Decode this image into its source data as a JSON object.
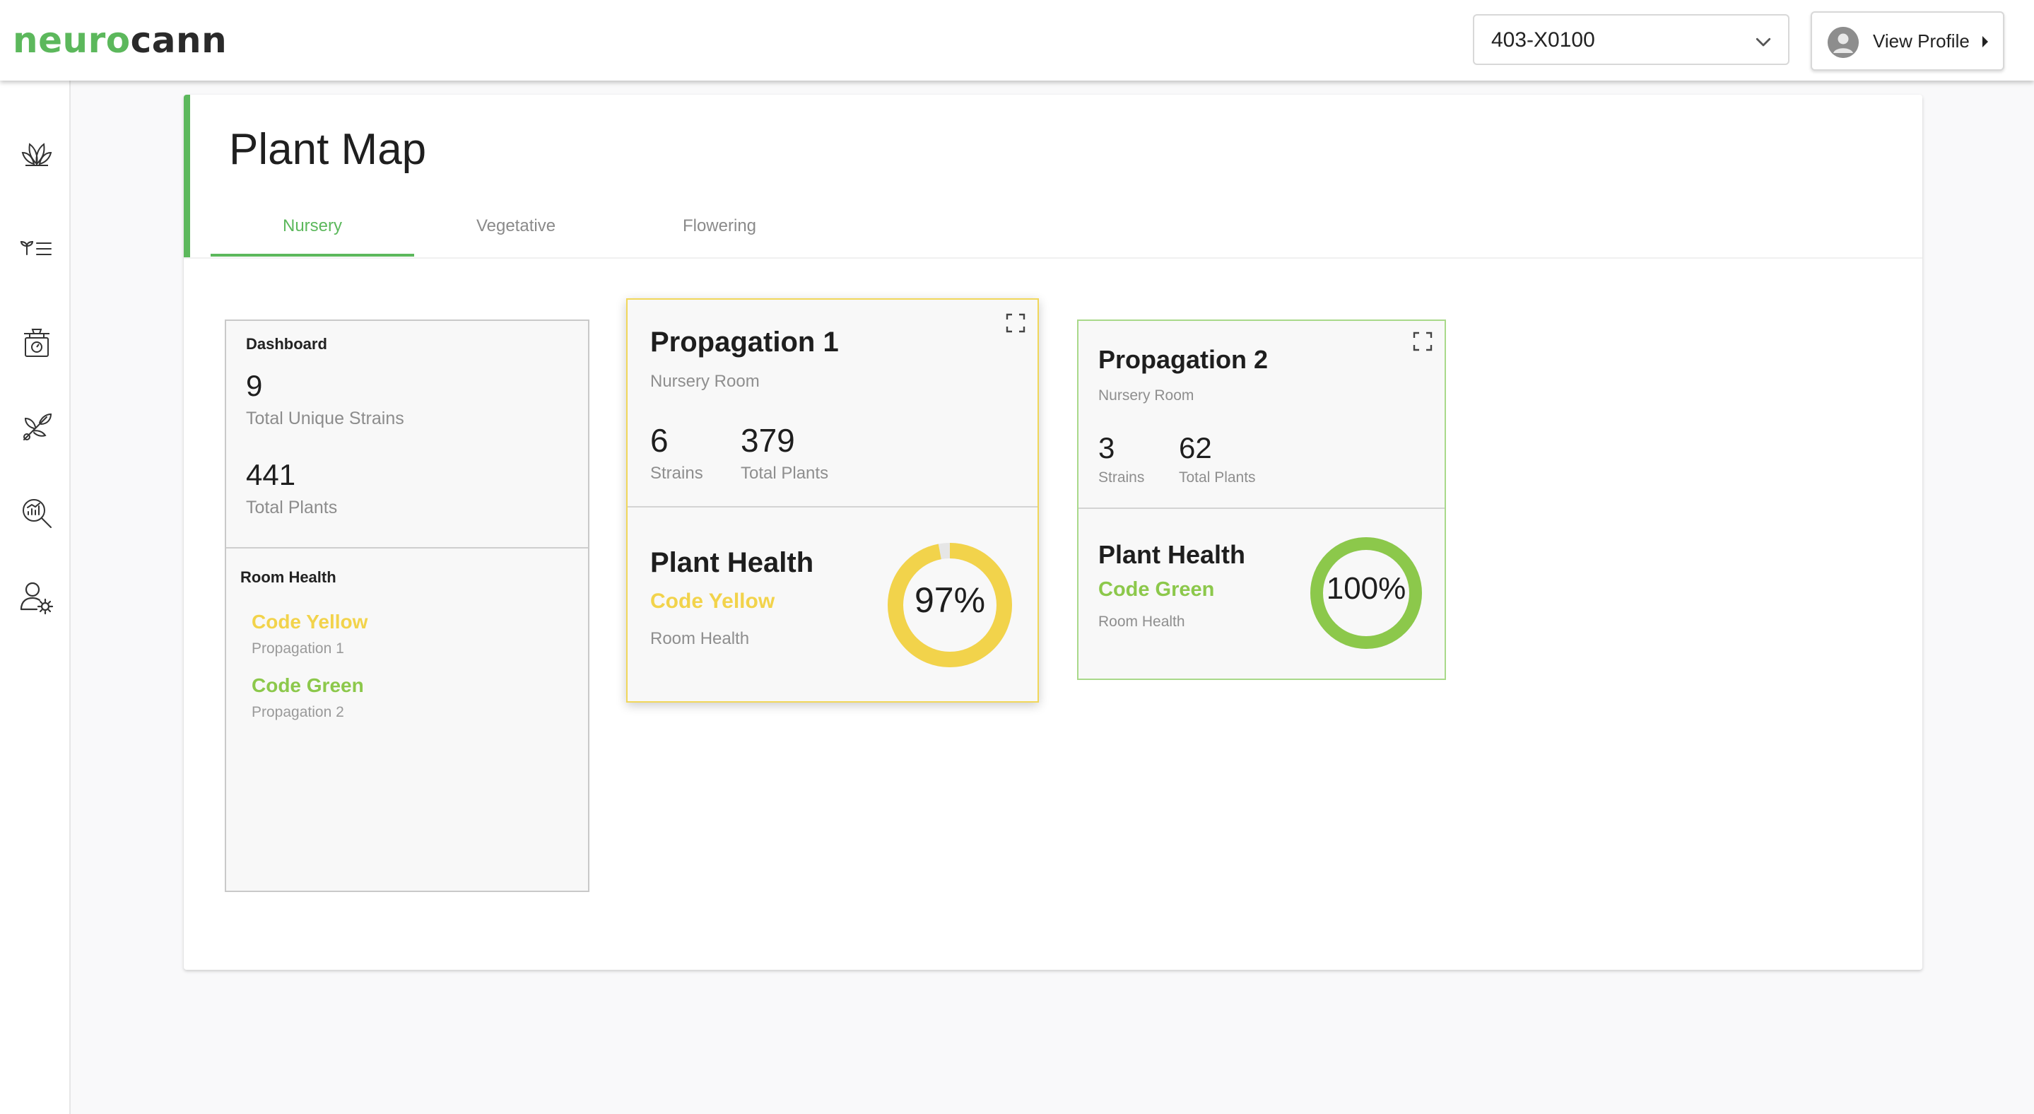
{
  "header": {
    "logo_part1": "neuro",
    "logo_part2": "cann",
    "facility_value": "403-X0100",
    "profile_label": "View Profile"
  },
  "sidebar": {
    "icons": [
      "plants-icon",
      "strain-list-icon",
      "scale-icon",
      "harvest-icon",
      "analytics-search-icon",
      "user-settings-icon"
    ]
  },
  "page": {
    "title": "Plant Map",
    "tabs": [
      {
        "label": "Nursery",
        "active": true
      },
      {
        "label": "Vegetative",
        "active": false
      },
      {
        "label": "Flowering",
        "active": false
      }
    ]
  },
  "dashboard": {
    "heading": "Dashboard",
    "unique_strains_value": "9",
    "unique_strains_label": "Total Unique Strains",
    "total_plants_value": "441",
    "total_plants_label": "Total Plants",
    "room_health_heading": "Room Health",
    "room_health": [
      {
        "code": "Code Yellow",
        "room": "Propagation 1",
        "color": "#f2d34b"
      },
      {
        "code": "Code Green",
        "room": "Propagation 2",
        "color": "#8cc84b"
      }
    ]
  },
  "rooms": [
    {
      "name": "Propagation 1",
      "room_type": "Nursery Room",
      "strains_value": "6",
      "strains_label": "Strains",
      "plants_value": "379",
      "plants_label": "Total Plants",
      "health_heading": "Plant Health",
      "health_code": "Code Yellow",
      "health_sub": "Room Health",
      "health_percent": 97,
      "health_text": "97%",
      "color": "#f2d34b"
    },
    {
      "name": "Propagation 2",
      "room_type": "Nursery Room",
      "strains_value": "3",
      "strains_label": "Strains",
      "plants_value": "62",
      "plants_label": "Total Plants",
      "health_heading": "Plant Health",
      "health_code": "Code Green",
      "health_sub": "Room Health",
      "health_percent": 100,
      "health_text": "100%",
      "color": "#8cc84b"
    }
  ],
  "colors": {
    "brand_green": "#5cb85c",
    "code_yellow": "#f2d34b",
    "code_green": "#8cc84b"
  }
}
